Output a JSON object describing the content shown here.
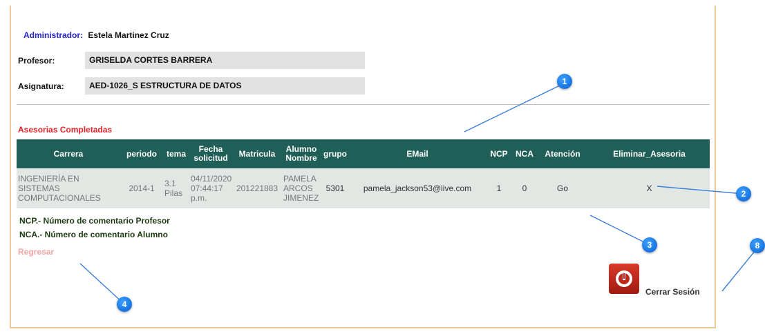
{
  "header": {
    "admin_label": "Administrador:",
    "admin_name": "Estela Martinez Cruz",
    "professor_label": "Profesor:",
    "professor_name": "GRISELDA CORTES BARRERA",
    "subject_label": "Asignatura:",
    "subject_name": "AED-1026_S ESTRUCTURA DE DATOS"
  },
  "section_title": "Asesorias Completadas",
  "table": {
    "columns": [
      "Carrera",
      "periodo",
      "tema",
      "Fecha solicitud",
      "Matricula",
      "Alumno Nombre",
      "grupo",
      "EMail",
      "NCP",
      "NCA",
      "Atención",
      "Eliminar_Asesoria"
    ],
    "rows": [
      {
        "carrera": "INGENIERÍA EN SISTEMAS COMPUTACIONALES",
        "periodo": "2014-1",
        "tema": "3.1 Pilas",
        "fecha": "04/11/2020 07:44:17 p.m.",
        "matricula": "201221883",
        "alumno": "PAMELA ARCOS JIMENEZ",
        "grupo": "5301",
        "email": "pamela_jackson53@live.com",
        "ncp": "1",
        "nca": "0",
        "atencion": "Go",
        "eliminar": "X"
      }
    ]
  },
  "legend": {
    "ncp": "NCP.- Número de comentario Profesor",
    "nca": "NCA.- Número de comentario Alumno"
  },
  "back_link": "Regresar",
  "logout_label": "Cerrar Sesión",
  "callouts": [
    "1",
    "2",
    "3",
    "4",
    "8"
  ],
  "colors": {
    "table_header": "#1f5f57",
    "table_row": "#e2e7e4",
    "section_title": "#e0242a",
    "admin_label": "#2323c8",
    "badge": "#0a5fd0",
    "panel_border": "#f0c898"
  }
}
